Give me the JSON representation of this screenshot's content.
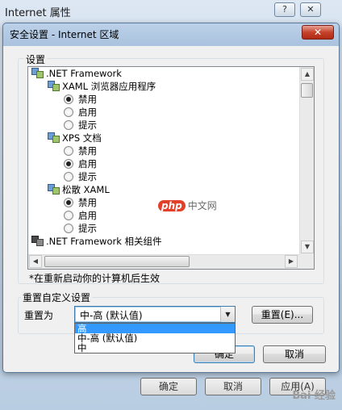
{
  "background_window": {
    "title": "Internet 属性",
    "help_button": "?",
    "close_button": "✕",
    "ok_label": "确定",
    "cancel_label": "取消",
    "apply_label": "应用(A)"
  },
  "dialog": {
    "title": "安全设置 - Internet 区域",
    "close_button": "✕",
    "settings_group_label": "设置",
    "tree": [
      {
        "type": "header",
        "icon": "net-settings-icon",
        "label": ".NET Framework"
      },
      {
        "type": "subheader",
        "icon": "net-settings-icon",
        "label": "XAML 浏览器应用程序"
      },
      {
        "type": "option",
        "label": "禁用",
        "selected": true
      },
      {
        "type": "option",
        "label": "启用",
        "selected": false
      },
      {
        "type": "option",
        "label": "提示",
        "selected": false
      },
      {
        "type": "subheader",
        "icon": "net-settings-icon",
        "label": "XPS 文档"
      },
      {
        "type": "option",
        "label": "禁用",
        "selected": false
      },
      {
        "type": "option",
        "label": "启用",
        "selected": true
      },
      {
        "type": "option",
        "label": "提示",
        "selected": false
      },
      {
        "type": "subheader",
        "icon": "net-settings-icon",
        "label": "松散 XAML"
      },
      {
        "type": "option",
        "label": "禁用",
        "selected": true
      },
      {
        "type": "option",
        "label": "启用",
        "selected": false
      },
      {
        "type": "option",
        "label": "提示",
        "selected": false
      },
      {
        "type": "header",
        "icon": "dark-settings-icon",
        "label": ".NET Framework 相关组件"
      }
    ],
    "restart_note": "*在重新启动你的计算机后生效",
    "reset_group_label": "重置自定义设置",
    "reset_to_label": "重置为",
    "reset_combo_value": "中-高 (默认值)",
    "reset_options": [
      "高",
      "中-高 (默认值)",
      "中"
    ],
    "reset_button": "重置(E)...",
    "ok_button": "确定",
    "cancel_button": "取消"
  },
  "watermarks": {
    "php_logo": "php",
    "php_text": "中文网",
    "baidu": "Bai 经验"
  },
  "colors": {
    "selection": "#3399ff",
    "close_red": "#c5432b",
    "titlebar": "#bcd1e8"
  }
}
